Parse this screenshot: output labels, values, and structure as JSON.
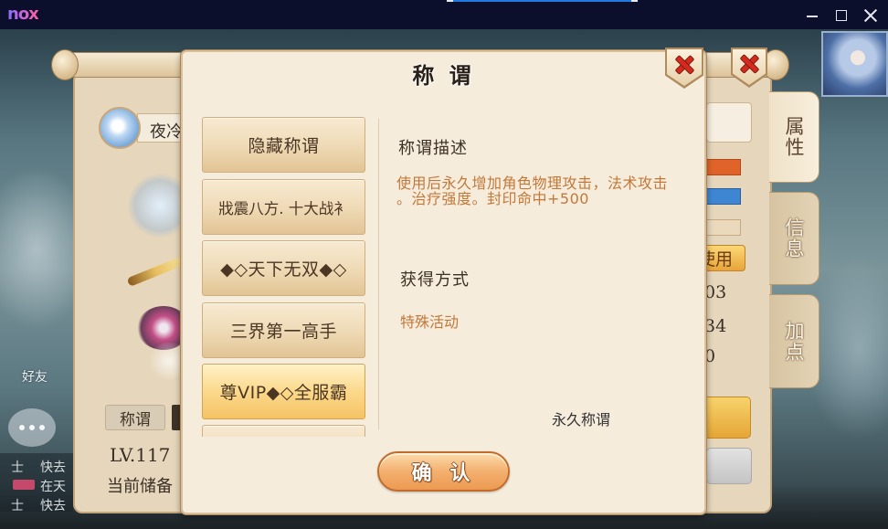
{
  "window": {
    "logo": "nox",
    "controls": [
      "minimize-icon",
      "maximize-icon",
      "close-icon"
    ]
  },
  "colors": {
    "title_bar": "#0b0f2b",
    "dialog_bg": "#f5ecdc",
    "heading": "#3d3024",
    "description": "#c47838",
    "list_item_selected": "#f5c364",
    "confirm_button": "#ec9a52",
    "close_x": "#d42a1e"
  },
  "background_panel": {
    "player_name": "夜冷",
    "title_tab_button": "称谓",
    "level": "LV.117",
    "reserve_label": "当前储备",
    "use_button": "使用",
    "stat_values": [
      "03",
      "34",
      "0"
    ],
    "side_tabs": [
      {
        "label": "属性",
        "active": true
      },
      {
        "label": "信息",
        "active": false
      },
      {
        "label": "加点",
        "active": false
      }
    ]
  },
  "chat": {
    "friends_label": "好友",
    "rows": [
      {
        "channel": "士",
        "text": "快去"
      },
      {
        "text": "在天"
      },
      {
        "channel": "士",
        "text": "快去"
      }
    ]
  },
  "dialog": {
    "title": "称 谓",
    "close_icon": "close-icon",
    "titles_list": [
      {
        "label": "隐藏称谓",
        "selected": false
      },
      {
        "label": "戕震八方. 十大战衤",
        "selected": false
      },
      {
        "label": "◆◇天下无双◆◇",
        "selected": false
      },
      {
        "label": "三界第一高手",
        "selected": false
      },
      {
        "label": "尊VIP◆◇全服霸",
        "selected": true
      }
    ],
    "description_heading": "称谓描述",
    "description_lines": [
      "使用后永久增加角色物理攻击，法术攻击",
      "。治疗强度。封印命中+500"
    ],
    "obtain_heading": "获得方式",
    "obtain_method": "特殊活动",
    "duration": "永久称谓",
    "confirm_label": "确 认"
  }
}
